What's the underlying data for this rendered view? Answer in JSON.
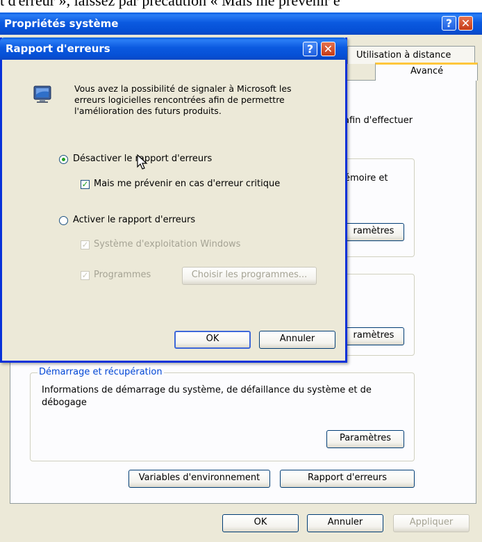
{
  "caption_fragment": "t d'erreur », laissez par précaution « Mais me prévenir e",
  "system_properties": {
    "title": "Propriétés système",
    "help_icon": "?",
    "close_icon": "✕",
    "tabs": {
      "remote": "Utilisation à distance",
      "advanced": "Avancé"
    },
    "perf_fragment": "afin d'effectuer",
    "memory_fragment": "émoire et",
    "settings_fragment_1": "ramètres",
    "settings_fragment_2": "ramètres",
    "startup": {
      "group_title": "Démarrage et récupération",
      "description": "Informations de démarrage du système, de défaillance du système et de débogage",
      "settings_button": "Paramètres"
    },
    "env_vars_button": "Variables d'environnement",
    "error_report_button": "Rapport d'erreurs",
    "ok_button": "OK",
    "cancel_button": "Annuler",
    "apply_button": "Appliquer"
  },
  "error_report_dialog": {
    "title": "Rapport d'erreurs",
    "help_icon": "?",
    "close_icon": "✕",
    "info_text": "Vous avez la possibilité de signaler à Microsoft les erreurs logicielles rencontrées afin de permettre l'amélioration des futurs produits.",
    "option_disable": "Désactiver le rapport d'erreurs",
    "option_notify_critical": "Mais me prévenir en cas d'erreur critique",
    "option_enable": "Activer le rapport d'erreurs",
    "option_windows": "Système d'exploitation Windows",
    "option_programs": "Programmes",
    "choose_programs_button": "Choisir les programmes...",
    "ok_button": "OK",
    "cancel_button": "Annuler",
    "selected": "disable",
    "notify_critical_checked": true,
    "windows_checked": true,
    "programs_checked": true
  }
}
